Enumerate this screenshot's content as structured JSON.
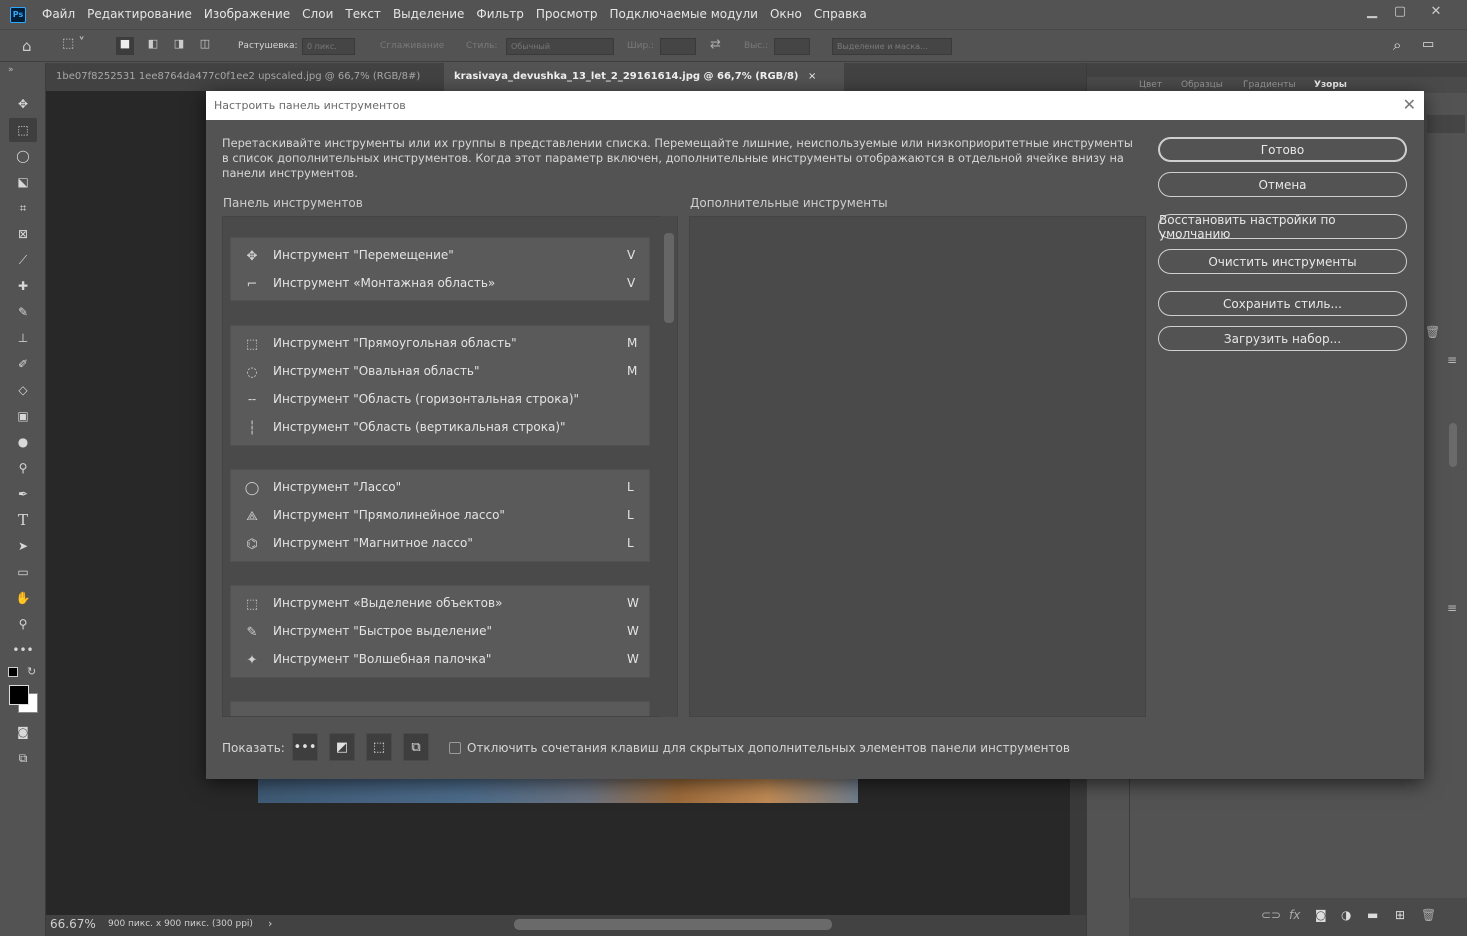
{
  "menu": {
    "logo": "Ps",
    "items": [
      "Файл",
      "Редактирование",
      "Изображение",
      "Слои",
      "Текст",
      "Выделение",
      "Фильтр",
      "Просмотр",
      "Подключаемые модули",
      "Окно",
      "Справка"
    ]
  },
  "options": {
    "feather_label": "Растушевка:",
    "feather_value": "0 пикс.",
    "antialias_label": "Сглаживание",
    "style_label": "Стиль:",
    "style_value": "Обычный",
    "width_label": "Шир.:",
    "height_label": "Выс.:",
    "select_mask_label": "Выделение и маска..."
  },
  "tabs": [
    {
      "label": "1be07f8252531 1ee8764da477c0f1ee2 upscaled.jpg @ 66,7% (RGB/8#)",
      "close": "×"
    },
    {
      "label": "krasivaya_devushka_13_let_2_29161614.jpg @ 66,7% (RGB/8)",
      "close": "×"
    }
  ],
  "status": {
    "zoom": "66.67%",
    "doc_info": "900 пикс. x 900 пикс. (300 ppi)",
    "arrow": "›"
  },
  "right_panel": {
    "tabs": [
      "Цвет",
      "Образцы",
      "Градиенты",
      "Узоры"
    ]
  },
  "dialog": {
    "title": "Настроить панель инструментов",
    "description": "Перетаскивайте инструменты или их группы в представлении списка. Перемещайте лишние, неиспользуемые или низкоприоритетные инструменты в список дополнительных инструментов. Когда этот параметр включен, дополнительные инструменты отображаются в отдельной ячейке внизу на панели инструментов.",
    "toolbar_header": "Панель инструментов",
    "extra_header": "Дополнительные инструменты",
    "groups": [
      {
        "tools": [
          {
            "icon": "move-icon",
            "glyph": "✥",
            "label": "Инструмент \"Перемещение\"",
            "key": "V"
          },
          {
            "icon": "artboard-icon",
            "glyph": "⌐",
            "label": "Инструмент «Монтажная область»",
            "key": "V"
          }
        ]
      },
      {
        "tools": [
          {
            "icon": "rect-marquee-icon",
            "glyph": "⬚",
            "label": "Инструмент \"Прямоугольная область\"",
            "key": "M"
          },
          {
            "icon": "ellipse-marquee-icon",
            "glyph": "◌",
            "label": "Инструмент \"Овальная область\"",
            "key": "M"
          },
          {
            "icon": "row-marquee-icon",
            "glyph": "╌",
            "label": "Инструмент \"Область (горизонтальная строка)\"",
            "key": ""
          },
          {
            "icon": "column-marquee-icon",
            "glyph": "┆",
            "label": "Инструмент \"Область (вертикальная строка)\"",
            "key": ""
          }
        ]
      },
      {
        "tools": [
          {
            "icon": "lasso-icon",
            "glyph": "◯",
            "label": "Инструмент \"Лассо\"",
            "key": "L"
          },
          {
            "icon": "polygonal-lasso-icon",
            "glyph": "⟁",
            "label": "Инструмент \"Прямолинейное лассо\"",
            "key": "L"
          },
          {
            "icon": "magnetic-lasso-icon",
            "glyph": "⌬",
            "label": "Инструмент \"Магнитное лассо\"",
            "key": "L"
          }
        ]
      },
      {
        "tools": [
          {
            "icon": "object-selection-icon",
            "glyph": "⬚",
            "label": "Инструмент «Выделение объектов»",
            "key": "W"
          },
          {
            "icon": "quick-selection-icon",
            "glyph": "✎",
            "label": "Инструмент \"Быстрое выделение\"",
            "key": "W"
          },
          {
            "icon": "magic-wand-icon",
            "glyph": "✦",
            "label": "Инструмент \"Волшебная палочка\"",
            "key": "W"
          }
        ]
      }
    ],
    "buttons": {
      "done": "Готово",
      "cancel": "Отмена",
      "restore": "Восстановить настройки по умолчанию",
      "clear": "Очистить инструменты",
      "save": "Сохранить стиль...",
      "load": "Загрузить набор..."
    },
    "show_label": "Показать:",
    "show_buttons": [
      "•••",
      "◩",
      "⬚",
      "⧉"
    ],
    "disable_shortcuts_label": "Отключить сочетания клавиш для скрытых дополнительных элементов панели инструментов",
    "close_glyph": "✕"
  }
}
